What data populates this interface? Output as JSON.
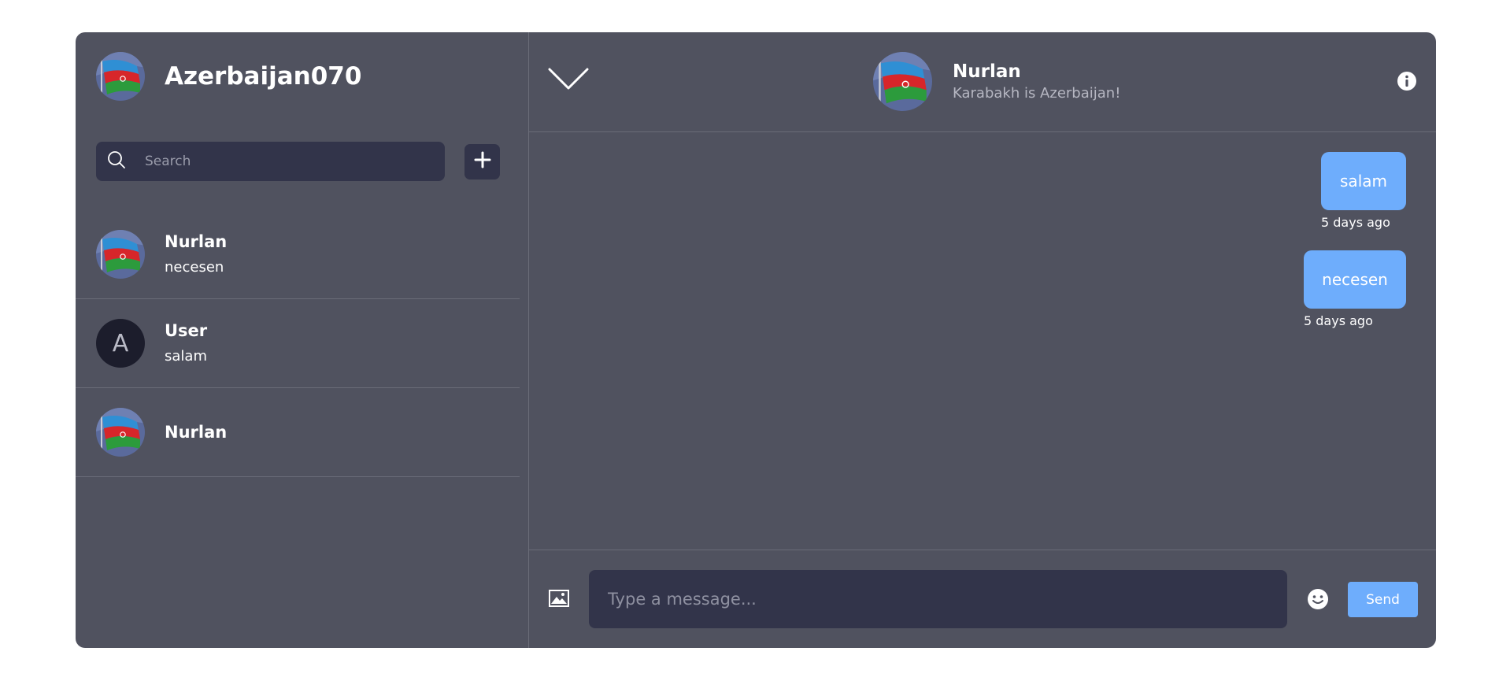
{
  "colors": {
    "panel": "#50525f",
    "input": "#32344a",
    "accent": "#6eadfc",
    "divider": "#6a6c78"
  },
  "profile": {
    "name": "Azerbaijan070",
    "avatar_icon": "azerbaijan-flag-avatar"
  },
  "search": {
    "placeholder": "Search",
    "icon": "search-icon"
  },
  "sidebar": {
    "add_icon": "plus-icon",
    "chats": [
      {
        "name": "Nurlan",
        "last_message": "necesen",
        "avatar": "azerbaijan-flag-avatar"
      },
      {
        "name": "User",
        "last_message": "salam",
        "avatar_letter": "A"
      },
      {
        "name": "Nurlan",
        "last_message": "",
        "avatar": "azerbaijan-flag-avatar"
      }
    ]
  },
  "header": {
    "collapse_icon": "chevron-down-icon",
    "contact_name": "Nurlan",
    "contact_status": "Karabakh is Azerbaijan!",
    "info_icon": "info-icon"
  },
  "messages": [
    {
      "text": "salam",
      "time": "5 days ago"
    },
    {
      "text": "necesen",
      "time": "5 days ago"
    }
  ],
  "composer": {
    "image_icon": "image-icon",
    "placeholder": "Type a message...",
    "emoji_icon": "emoji-icon",
    "send_label": "Send"
  }
}
